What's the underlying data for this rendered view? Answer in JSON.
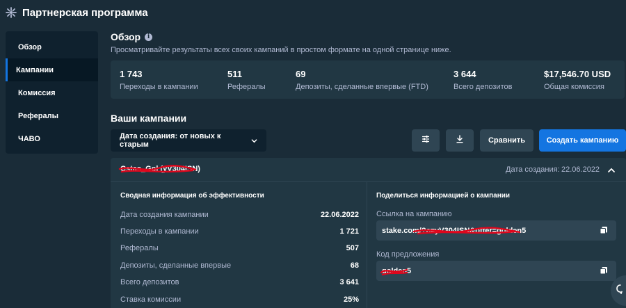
{
  "header": {
    "title": "Партнерская программа",
    "icon": "affiliate-icon"
  },
  "sidebar": {
    "items": [
      {
        "label": "Обзор",
        "active": false
      },
      {
        "label": "Кампании",
        "active": true
      },
      {
        "label": "Комиссия",
        "active": false
      },
      {
        "label": "Рефералы",
        "active": false
      },
      {
        "label": "ЧАВО",
        "active": false
      }
    ]
  },
  "overview": {
    "title": "Обзор",
    "subtitle": "Просматривайте результаты всех своих кампаний в простом формате на одной странице ниже.",
    "stats": [
      {
        "value": "1 743",
        "label": "Переходы в кампании"
      },
      {
        "value": "511",
        "label": "Рефералы"
      },
      {
        "value": "69",
        "label": "Депозиты, сделанные впервые (FTD)"
      },
      {
        "value": "3 644",
        "label": "Всего депозитов"
      },
      {
        "value": "$17,546.70 USD",
        "label": "Общая комиссия"
      }
    ]
  },
  "campaigns": {
    "title": "Ваши кампании",
    "sort_label": "Дата создания: от новых к старым",
    "compare_label": "Сравнить",
    "create_label": "Создать кампанию",
    "card": {
      "name": "Cstas_Gol (yV304ISN)",
      "date_label": "Дата создания:",
      "date_value": "22.06.2022",
      "performance": {
        "title": "Сводная информация об эффективности",
        "rows": [
          {
            "label": "Дата создания кампании",
            "value": "22.06.2022"
          },
          {
            "label": "Переходы в кампании",
            "value": "1 721"
          },
          {
            "label": "Рефералы",
            "value": "507"
          },
          {
            "label": "Депозиты, сделанные впервые",
            "value": "68"
          },
          {
            "label": "Всего депозитов",
            "value": "3 641"
          },
          {
            "label": "Ставка комиссии",
            "value": "25%"
          }
        ]
      },
      "share": {
        "title": "Поделиться информацией о кампании",
        "link_label": "Ссылка на кампанию",
        "link_value": "stake.com/?c=yV304ISN&offer=golden5",
        "code_label": "Код предложения",
        "code_value": "golden5"
      }
    }
  },
  "colors": {
    "background": "#1a2c38",
    "panel": "#213743",
    "sidebar": "#0f212e",
    "accent": "#1475e1",
    "muted_text": "#b1bad3",
    "redaction": "#e0061c"
  }
}
